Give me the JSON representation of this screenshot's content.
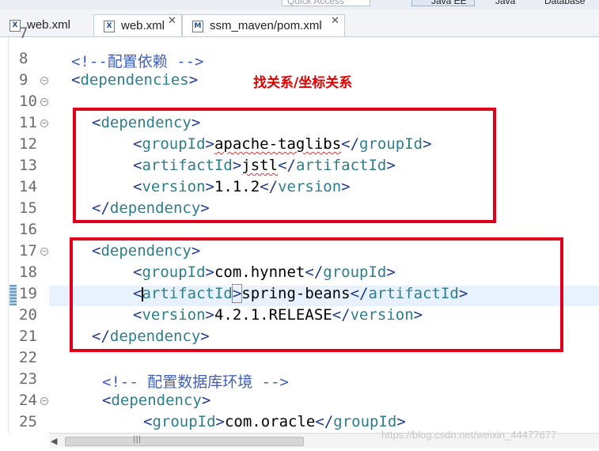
{
  "toolbar": {
    "quick_access_placeholder": "Quick Access",
    "perspectives": [
      "Java EE",
      "Java",
      "Database"
    ]
  },
  "tabs": [
    {
      "icon": "xml-file-icon",
      "label": "web.xml",
      "active": false
    },
    {
      "icon": "xml-file-icon",
      "label": "web.xml",
      "active": true,
      "close": "✕"
    },
    {
      "icon": "maven-pom-icon",
      "label": "ssm_maven/pom.xml",
      "active": true,
      "close": "✕"
    }
  ],
  "editor": {
    "line_numbers": [
      "7",
      "8",
      "9",
      "10",
      "11",
      "12",
      "13",
      "14",
      "15",
      "16",
      "17",
      "18",
      "19",
      "20",
      "21",
      "22",
      "23",
      "24",
      "25"
    ],
    "annotation": "找关系/坐标关系",
    "lines": {
      "l8": "配置依赖",
      "l9_tag": "dependencies",
      "l11_tag": "dependency",
      "l12": {
        "tag": "groupId",
        "value": "apache-taglibs"
      },
      "l13": {
        "tag": "artifactId",
        "value": "jstl"
      },
      "l14": {
        "tag": "version",
        "value": "1.1.2"
      },
      "l15_tag": "dependency",
      "l17_tag": "dependency",
      "l18": {
        "tag": "groupId",
        "value": "com.hynnet"
      },
      "l19": {
        "tag": "artifactId",
        "value": "spring-beans"
      },
      "l20": {
        "tag": "version",
        "value": "4.2.1.RELEASE"
      },
      "l21_tag": "dependency",
      "l23": "配置数据库环境",
      "l24_tag": "dependency",
      "l25": {
        "tag": "groupId",
        "value": "com.oracle"
      }
    }
  },
  "scrollbar": {
    "grip": "|||"
  },
  "watermark": "https://blog.csdn.net/weixin_44477677",
  "colors": {
    "tag": "#2e7d8a",
    "comment": "#3f5fbf",
    "annotation": "#e00000",
    "highlight_box": "#e0001b"
  }
}
